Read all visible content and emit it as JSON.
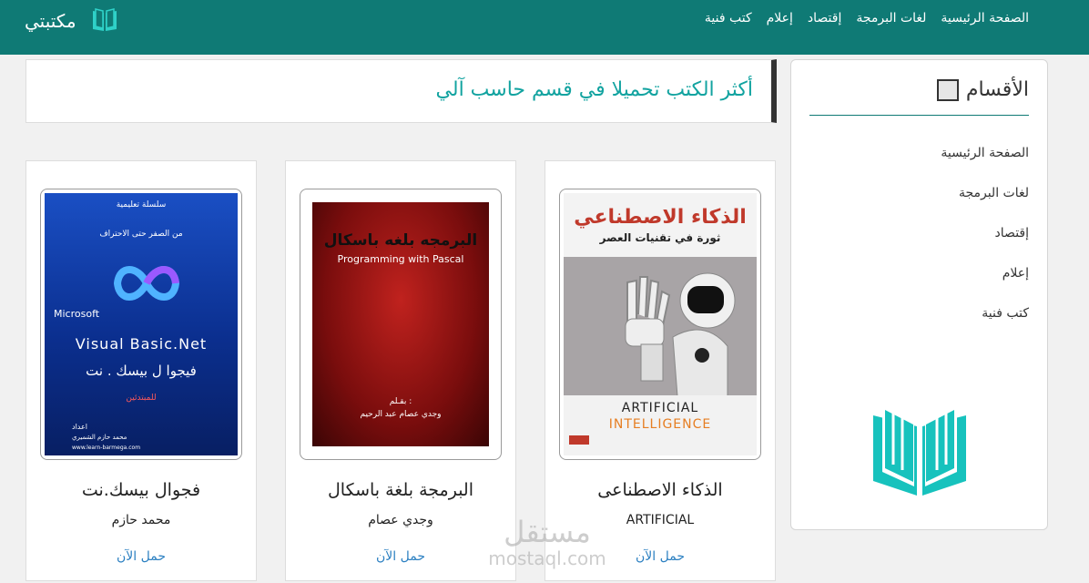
{
  "brand": {
    "name": "مكتبتي"
  },
  "nav": {
    "items": [
      "الصفحة الرئيسية",
      "لغات البرمجة",
      "إقتصاد",
      "إعلام",
      "كتب فنية"
    ]
  },
  "sidebar": {
    "title": "الأقسام",
    "items": [
      "الصفحة الرئيسية",
      "لغات البرمجة",
      "إقتصاد",
      "إعلام",
      "كتب فنية"
    ]
  },
  "section": {
    "title": "أكثر الكتب تحميلا في قسم حاسب آلي"
  },
  "books": [
    {
      "title": "الذكاء الاصطناعى",
      "author": "ARTIFICIAL",
      "download": "حمل الآن",
      "cover": {
        "ar_title": "الذكاء الاصطناعي",
        "ar_subtitle": "ثورة في تقنيات العصر",
        "en_line1": "ARTIFICIAL",
        "en_line2": "INTELLIGENCE"
      }
    },
    {
      "title": "البرمجة بلغة باسكال",
      "author": "وجدي عصام",
      "download": "حمل الآن",
      "cover": {
        "ar_title": "البرمجه بلغه باسكال",
        "en_title": "Programming with Pascal",
        "by_label": "بقـلم :",
        "by_name": "وجدي عصام عبد الرحيم"
      }
    },
    {
      "title": "فجوال بيسك.نت",
      "author": "محمد حازم",
      "download": "حمل الآن",
      "cover": {
        "series": "سلسلة تعليمية",
        "series_sub": "من الصفر حتى الاحتراف",
        "ms": "Microsoft",
        "en_title": "Visual Basic.Net",
        "ar_title": "فيجوا ل بيسك . نت",
        "for": "للمبتدئين",
        "prep": "اعداد",
        "author": "محمد حازم الشميري",
        "site": "www.learn-barmega.com"
      }
    }
  ],
  "watermark": {
    "ar": "مستقل",
    "en": "mostaql.com"
  },
  "colors": {
    "navbar": "#0f7a75",
    "accent": "#12a3a0",
    "link": "#2a7fc1"
  }
}
